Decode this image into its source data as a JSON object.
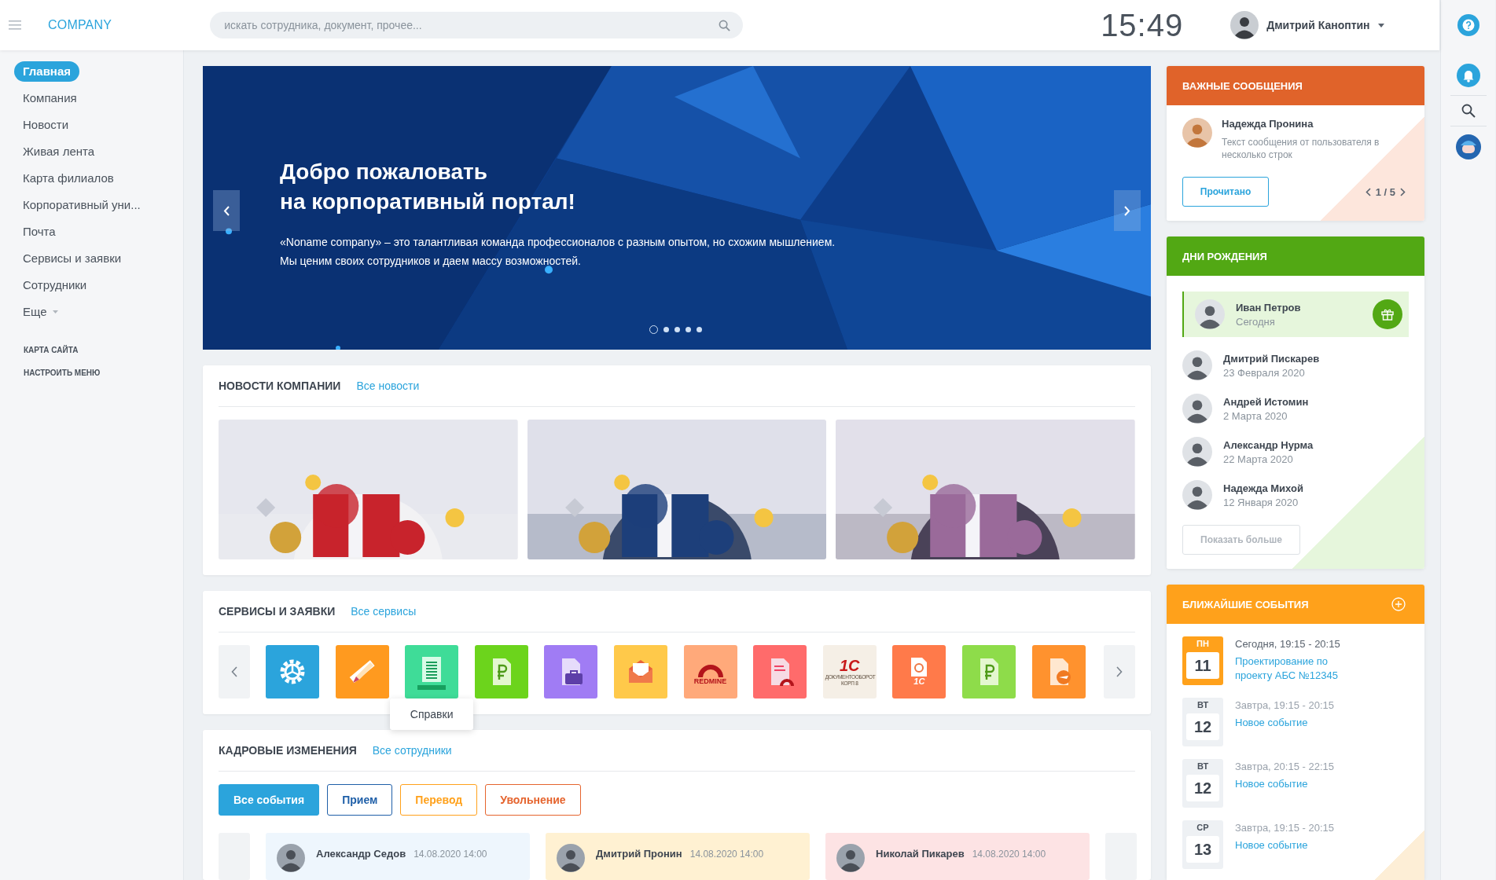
{
  "topbar": {
    "logo": "COMPANY",
    "search": {
      "placeholder": "искать сотрудника, документ, прочее..."
    },
    "clock": "15:49",
    "user": {
      "name": "Дмитрий Каноптин"
    }
  },
  "sidebar": {
    "items": [
      {
        "label": "Главная",
        "selected": true,
        "has_menu": false
      },
      {
        "label": "Компания",
        "selected": false,
        "has_menu": false
      },
      {
        "label": "Новости",
        "selected": false,
        "has_menu": false
      },
      {
        "label": "Живая лента",
        "selected": false,
        "has_menu": false
      },
      {
        "label": "Карта филиалов",
        "selected": false,
        "has_menu": false
      },
      {
        "label": "Корпоративный уни...",
        "selected": false,
        "has_menu": false
      },
      {
        "label": "Почта",
        "selected": false,
        "has_menu": false
      },
      {
        "label": "Сервисы и заявки",
        "selected": false,
        "has_menu": false
      },
      {
        "label": "Сотрудники",
        "selected": false,
        "has_menu": false
      },
      {
        "label": "Еще",
        "selected": false,
        "has_menu": true
      }
    ],
    "links": [
      "КАРТА САЙТА",
      "НАСТРОИТЬ МЕНЮ"
    ]
  },
  "banner": {
    "title_lines": [
      "Добро пожаловать",
      "на корпоративный портал!"
    ],
    "text": "«Noname company» – это талантливая команда профессионалов с разным опытом, но схожим мышлением.  Мы ценим своих сотрудников и даем массу возможностей.",
    "dots": [
      {
        "selected": true
      },
      {
        "selected": false
      },
      {
        "selected": false
      },
      {
        "selected": false
      },
      {
        "selected": false
      }
    ]
  },
  "news": {
    "title": "НОВОСТИ КОМПАНИИ",
    "link": "Все новости"
  },
  "services": {
    "title": "СЕРВИСЫ И ЗАЯВКИ",
    "link": "Все сервисы",
    "items": [
      {
        "kind": "gear",
        "color": "#2ba4dc"
      },
      {
        "kind": "ruler",
        "color": "#ff9a1f"
      },
      {
        "kind": "list",
        "color": "#3fdc98",
        "tooltip": "Справки"
      },
      {
        "kind": "ruble",
        "color": "#6cd41c"
      },
      {
        "kind": "briefcase",
        "color": "#a07cf4"
      },
      {
        "kind": "envelope",
        "color": "#ffc94a"
      },
      {
        "kind": "arch",
        "color": "#ffa97a",
        "logo_text": "REDMINE"
      },
      {
        "kind": "docarch",
        "color": "#ff6b6b"
      },
      {
        "kind": "onec",
        "color": "#f5efe6",
        "logo_text": "1С",
        "caption": "ДОКУМЕНТООБОРОТ КОРП 8"
      },
      {
        "kind": "sync",
        "color": "#ff7a4a",
        "logo_text": "1С"
      },
      {
        "kind": "ruble",
        "color": "#8edc4a"
      },
      {
        "kind": "plane",
        "color": "#ff922e"
      }
    ]
  },
  "hr": {
    "title": "КАДРОВЫЕ ИЗМЕНЕНИЯ",
    "link": "Все сотрудники",
    "filters": [
      {
        "label": "Все события",
        "selected": true,
        "color": "#2ba4dc"
      },
      {
        "label": "Прием",
        "selected": false,
        "color": "#1f5fa8"
      },
      {
        "label": "Перевод",
        "selected": false,
        "color": "#ffa11b"
      },
      {
        "label": "Увольнение",
        "selected": false,
        "color": "#e5642e"
      }
    ],
    "cards": [
      {
        "name": "Александр Седов",
        "date": "14.08.2020 14:00",
        "color": "#eef6fd"
      },
      {
        "name": "Дмитрий Пронин",
        "date": "14.08.2020 14:00",
        "color": "#fff1d2"
      },
      {
        "name": "Николай Пикарев",
        "date": "14.08.2020 14:00",
        "color": "#fde3e4"
      }
    ]
  },
  "important": {
    "title": "ВАЖНЫЕ СООБЩЕНИЯ",
    "author": "Надежда Пронина",
    "text": "Текст сообщения от пользователя в несколько строк",
    "button": "Прочитано",
    "pager": "1 / 5"
  },
  "birthdays": {
    "title": "ДНИ РОЖДЕНИЯ",
    "people": [
      {
        "name": "Иван Петров",
        "date": "Сегодня",
        "today": true
      },
      {
        "name": "Дмитрий Пискарев",
        "date": "23 Февраля 2020",
        "today": false
      },
      {
        "name": "Андрей Истомин",
        "date": "2 Марта 2020",
        "today": false
      },
      {
        "name": "Александр Нурма",
        "date": "22 Марта 2020",
        "today": false
      },
      {
        "name": "Надежда Михой",
        "date": "12 Января 2020",
        "today": false
      }
    ],
    "button": "Показать больше"
  },
  "events": {
    "title": "БЛИЖАЙШИЕ СОБЫТИЯ",
    "items": [
      {
        "weekday": "ПН",
        "day": "11",
        "time": "Сегодня, 19:15 - 20:15",
        "title": "Проектирование по проекту АБС №12345",
        "today": true
      },
      {
        "weekday": "ВТ",
        "day": "12",
        "time": "Завтра, 19:15 - 20:15",
        "title": "Новое событие",
        "today": false
      },
      {
        "weekday": "ВТ",
        "day": "12",
        "time": "Завтра, 20:15 - 22:15",
        "title": "Новое событие",
        "today": false
      },
      {
        "weekday": "СР",
        "day": "13",
        "time": "Завтра, 19:15 - 20:15",
        "title": "Новое событие",
        "today": false
      }
    ]
  }
}
